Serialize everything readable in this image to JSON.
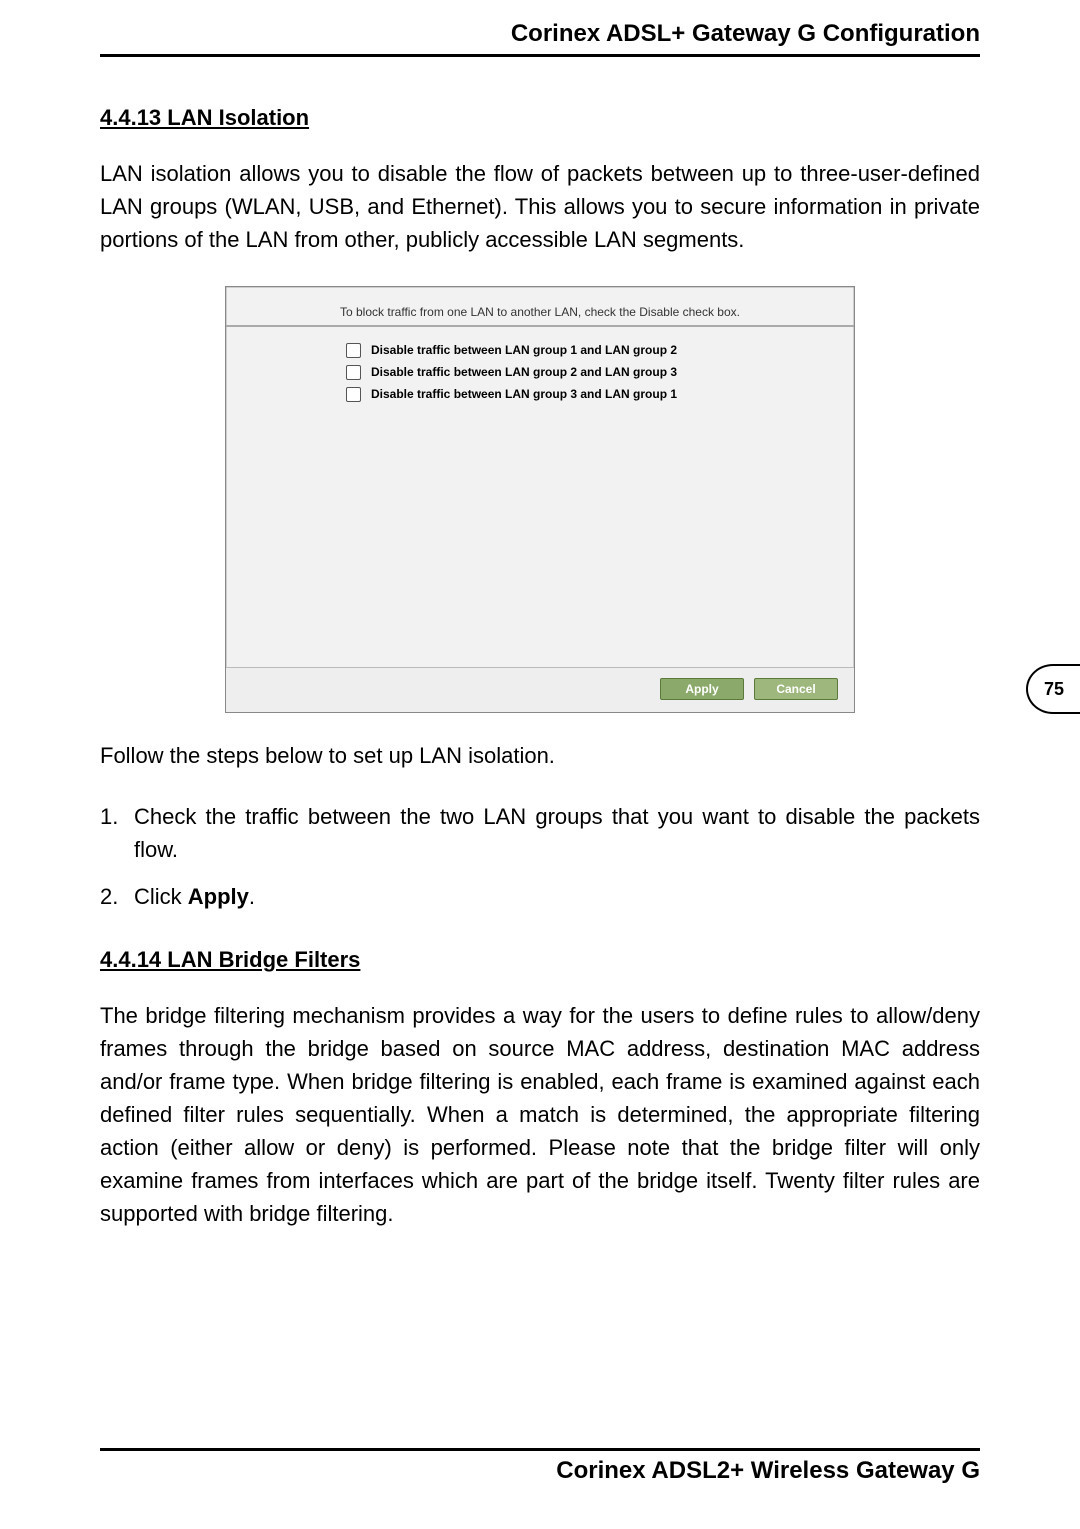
{
  "header": {
    "title": "Corinex ADSL+ Gateway G Configuration"
  },
  "page_tab": {
    "number": "75"
  },
  "section_4413": {
    "heading": "4.4.13  LAN Isolation",
    "paragraph": "LAN isolation allows you to disable the flow of packets between up to three-user-defined LAN groups (WLAN, USB, and Ethernet). This allows you to secure information in private portions of the LAN from other, publicly accessible LAN segments."
  },
  "ui_panel": {
    "hint": "To block traffic from one LAN to another LAN, check the Disable check box.",
    "options": [
      {
        "checked": false,
        "label": "Disable traffic between LAN group 1 and LAN group 2"
      },
      {
        "checked": false,
        "label": "Disable traffic between LAN group 2 and LAN group 3"
      },
      {
        "checked": false,
        "label": "Disable traffic between LAN group 3 and LAN group 1"
      }
    ],
    "buttons": {
      "apply": "Apply",
      "cancel": "Cancel"
    }
  },
  "steps": {
    "intro": "Follow the steps below to set up LAN isolation.",
    "items": [
      "Check the traffic between the two LAN groups that you want to disable the packets flow.",
      {
        "prefix": "Click ",
        "strong": "Apply",
        "suffix": "."
      }
    ]
  },
  "section_4414": {
    "heading": "4.4.14  LAN Bridge Filters",
    "paragraph": "The bridge filtering mechanism provides a way for the users to define rules to allow/deny frames through the bridge based on source MAC address, destination MAC address and/or frame type. When bridge filtering is enabled, each frame is examined against each defined filter rules sequentially. When a match is determined, the appropriate filtering action (either allow or deny) is performed. Please note that the bridge filter will only examine frames from interfaces which are part of the bridge itself. Twenty filter rules are supported with bridge filtering."
  },
  "footer": {
    "title": "Corinex ADSL2+ Wireless Gateway G"
  }
}
